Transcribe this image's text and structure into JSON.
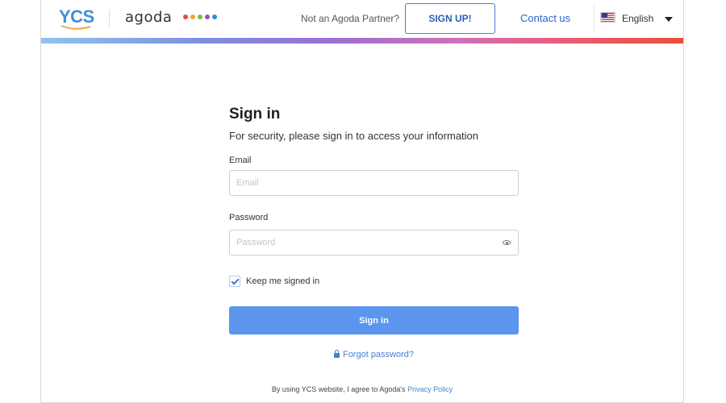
{
  "header": {
    "ycs_logo": "YCS",
    "agoda_logo": "agoda",
    "agoda_dot_colors": [
      "#e84a3c",
      "#f2a33a",
      "#7bc043",
      "#8e5ab5",
      "#2f8fd8"
    ],
    "partner_prompt": "Not an Agoda Partner?",
    "signup_label": "SIGN UP!",
    "contact_label": "Contact us",
    "language": "English"
  },
  "form": {
    "title": "Sign in",
    "subtitle": "For security, please sign in to access your information",
    "email_label": "Email",
    "email_placeholder": "Email",
    "email_value": "",
    "password_label": "Password",
    "password_placeholder": "Password",
    "password_value": "",
    "keep_signed_in_label": "Keep me signed in",
    "keep_signed_in_checked": true,
    "signin_label": "Sign in",
    "forgot_label": "Forgot password?"
  },
  "footer": {
    "text": "By using YCS website, I agree to Agoda's",
    "link": "Privacy Policy"
  },
  "colors": {
    "accent": "#5b95ee",
    "link": "#2c63c9"
  }
}
